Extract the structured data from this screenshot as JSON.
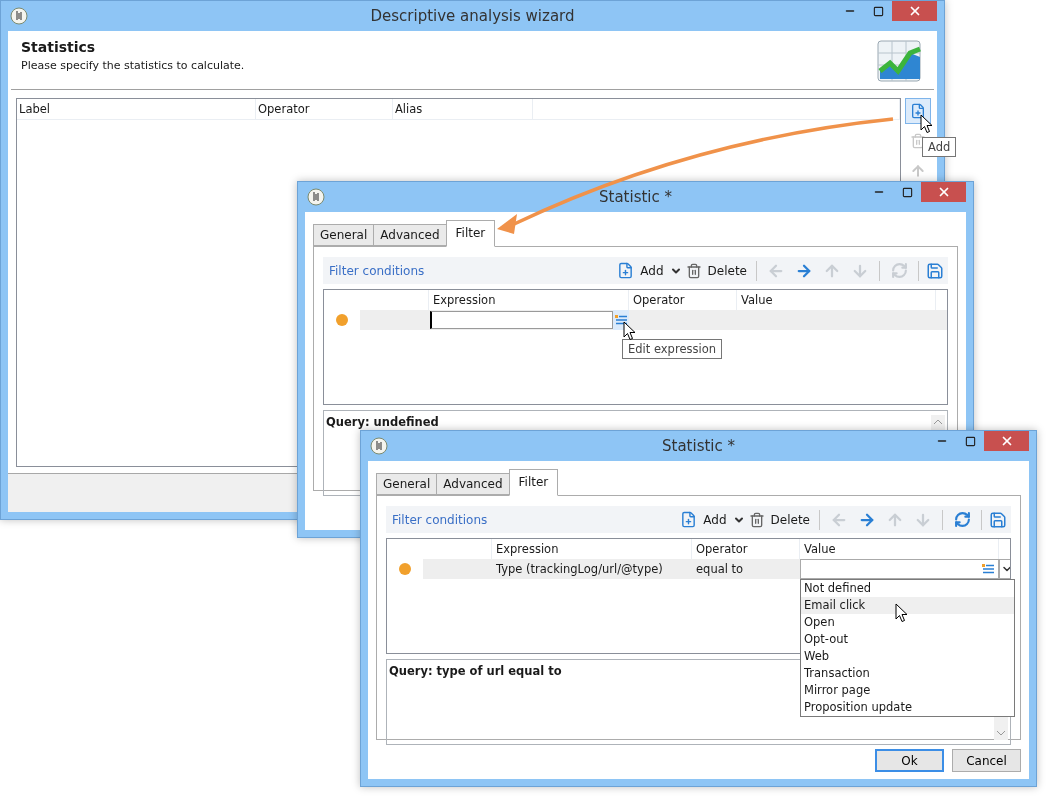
{
  "wizard_window": {
    "title": "Descriptive analysis wizard",
    "heading": "Statistics",
    "subtitle": "Please specify the statistics to calculate.",
    "columns": [
      "Label",
      "Operator",
      "Alias"
    ],
    "side_buttons": [
      {
        "kind": "add",
        "hovered": true,
        "disabled": false
      },
      {
        "kind": "delete",
        "hovered": false,
        "disabled": true
      },
      {
        "kind": "up",
        "hovered": false,
        "disabled": true
      }
    ],
    "tooltip": "Add"
  },
  "statistic_window_back": {
    "title": "Statistic *",
    "tabs": [
      {
        "label": "General",
        "selected": false
      },
      {
        "label": "Advanced",
        "selected": false
      },
      {
        "label": "Filter",
        "selected": true
      }
    ],
    "toolbar": {
      "title": "Filter conditions",
      "add": "Add",
      "delete": "Delete",
      "tools": [
        {
          "kind": "left",
          "disabled": true
        },
        {
          "kind": "right",
          "disabled": false
        },
        {
          "kind": "up",
          "disabled": true
        },
        {
          "kind": "down",
          "disabled": true
        },
        {
          "kind": "refresh",
          "disabled": true
        }
      ]
    },
    "columns": [
      "Expression",
      "Operator",
      "Value"
    ],
    "row": {
      "editing": true
    },
    "tooltip": "Edit expression",
    "query": "Query: undefined"
  },
  "statistic_window_front": {
    "title": "Statistic *",
    "tabs": [
      {
        "label": "General",
        "selected": false
      },
      {
        "label": "Advanced",
        "selected": false
      },
      {
        "label": "Filter",
        "selected": true
      }
    ],
    "toolbar": {
      "title": "Filter conditions",
      "add": "Add",
      "delete": "Delete",
      "tools": [
        {
          "kind": "left",
          "disabled": true
        },
        {
          "kind": "right",
          "disabled": false
        },
        {
          "kind": "up",
          "disabled": true
        },
        {
          "kind": "down",
          "disabled": true
        },
        {
          "kind": "refresh",
          "disabled": false
        }
      ]
    },
    "columns": [
      "Expression",
      "Operator",
      "Value"
    ],
    "row": {
      "editing": false,
      "expression": "Type (trackingLog/url/@type)",
      "operator": "equal to"
    },
    "dropdown": [
      {
        "label": "Not defined",
        "selected": false
      },
      {
        "label": "Email click",
        "selected": true
      },
      {
        "label": "Open",
        "selected": false
      },
      {
        "label": "Opt-out",
        "selected": false
      },
      {
        "label": "Web",
        "selected": false
      },
      {
        "label": "Transaction",
        "selected": false
      },
      {
        "label": "Mirror page",
        "selected": false
      },
      {
        "label": "Proposition update",
        "selected": false
      }
    ],
    "query": "Query: type of url equal to",
    "buttons": [
      {
        "label": "Ok",
        "default": true
      },
      {
        "label": "Cancel",
        "default": false
      }
    ]
  }
}
